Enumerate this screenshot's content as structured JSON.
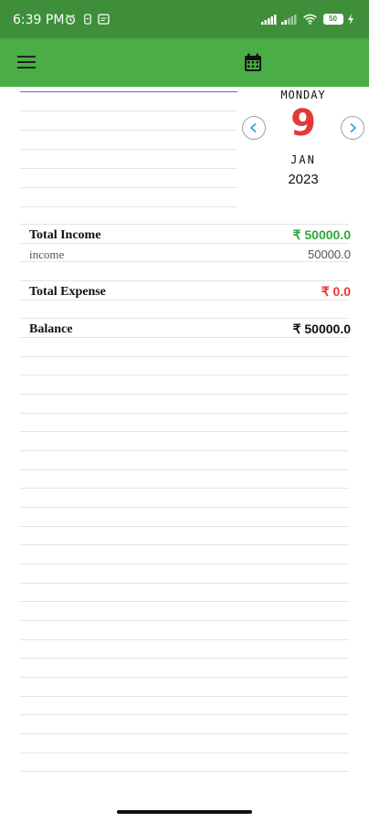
{
  "status": {
    "time": "6:39 PM",
    "battery": "50"
  },
  "app": {
    "menu_icon": "hamburger-menu-icon",
    "calendar_icon": "calendar-icon"
  },
  "date": {
    "day_name": "MONDAY",
    "day_number": "9",
    "month": "JAN",
    "year": "2023"
  },
  "summary": {
    "total_income_label": "Total Income",
    "total_income_value": "₹ 50000.0",
    "income_label": "income",
    "income_value": "50000.0",
    "total_expense_label": "Total Expense",
    "total_expense_value": "₹ 0.0",
    "balance_label": "Balance",
    "balance_value": "₹ 50000.0"
  },
  "colors": {
    "statusbar": "#3f8f3a",
    "appbar": "#4aad46",
    "income": "#2ea83a",
    "expense": "#e53935"
  }
}
